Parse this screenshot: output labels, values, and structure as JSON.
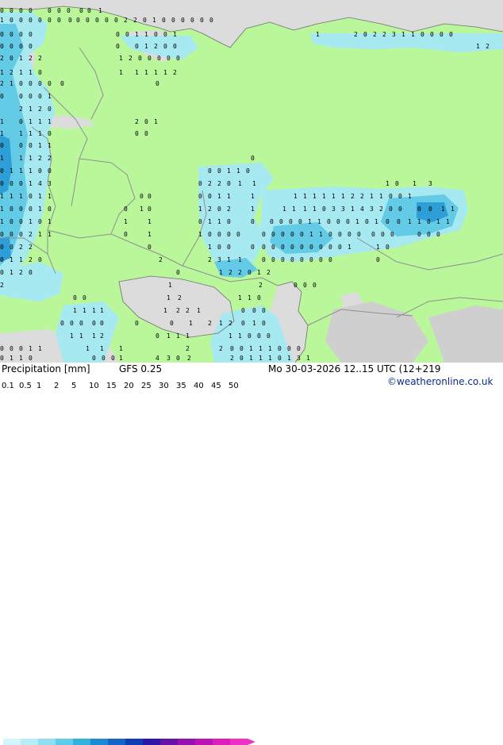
{
  "title": "Precipitation [mm]",
  "model": "GFS 0.25",
  "datetime": "Mo 30-03-2026 12..15 UTC (12+219",
  "credit": "©weatheronline.co.uk",
  "colors": {
    "land": "#b9f79a",
    "sea": "#dcdcdc",
    "light_precip": "#a7e9f1",
    "medium_precip": "#63cbe6",
    "heavy_precip": "#2e9fd6",
    "border": "#8f8f8f"
  },
  "legend": {
    "labels": [
      "0.1",
      "0.5",
      "1",
      "2",
      "5",
      "10",
      "15",
      "20",
      "25",
      "30",
      "35",
      "40",
      "45",
      "50"
    ],
    "colors": [
      "#d3f5fb",
      "#b6ecf7",
      "#8fdff1",
      "#5fcbe8",
      "#33b1dd",
      "#1e8bd1",
      "#1565c4",
      "#0e3eb5",
      "#2d15a7",
      "#6611a8",
      "#9510ad",
      "#bb13b3",
      "#de1cba",
      "#f02fc6"
    ]
  },
  "values": [
    "0",
    "0",
    "0",
    "0",
    "0",
    "0",
    "0",
    "0",
    "0",
    "1",
    "1",
    "0",
    "0",
    "0",
    "0",
    "0",
    "0",
    "0",
    "0",
    "0",
    "0",
    "0",
    "0",
    "2",
    "2",
    "0",
    "1",
    "0",
    "0",
    "0",
    "0",
    "0",
    "0",
    "0",
    "0",
    "0",
    "0",
    "0",
    "0",
    "1",
    "1",
    "0",
    "0",
    "1",
    "1",
    "2",
    "0",
    "2",
    "2",
    "3",
    "1",
    "1",
    "0",
    "0",
    "0",
    "0",
    "0",
    "0",
    "0",
    "0",
    "0",
    "0",
    "1",
    "2",
    "0",
    "0",
    "1",
    "2",
    "2",
    "0",
    "1",
    "2",
    "2",
    "1",
    "2",
    "0",
    "0",
    "0",
    "0",
    "0",
    "1",
    "2",
    "1",
    "1",
    "0",
    "1",
    "1",
    "1",
    "1",
    "1",
    "2",
    "2",
    "1",
    "0",
    "0",
    "0",
    "0",
    "0",
    "0",
    "0",
    "0",
    "0",
    "0",
    "1",
    "2",
    "1",
    "2",
    "0",
    "1",
    "0",
    "1",
    "1",
    "1",
    "2",
    "0",
    "1",
    "1",
    "1",
    "1",
    "1",
    "0",
    "0",
    "0",
    "0",
    "0",
    "0",
    "1",
    "1",
    "1",
    "1",
    "1",
    "2",
    "2",
    "0",
    "0",
    "1",
    "1",
    "1",
    "0",
    "0",
    "0",
    "0",
    "1",
    "1",
    "0",
    "0",
    "0",
    "0",
    "1",
    "4",
    "3",
    "0",
    "2",
    "2",
    "0",
    "1",
    "1",
    "1",
    "0",
    "1",
    "3",
    "1",
    "1",
    "1",
    "0",
    "1",
    "1",
    "0",
    "0",
    "0",
    "0",
    "1",
    "1",
    "1",
    "1",
    "1",
    "1",
    "1",
    "1",
    "1",
    "2",
    "2",
    "1",
    "1",
    "0",
    "0",
    "1",
    "1",
    "0",
    "0",
    "0",
    "1",
    "0",
    "0",
    "1",
    "0",
    "1",
    "2",
    "0",
    "2",
    "1",
    "1",
    "1",
    "1",
    "1",
    "0",
    "3",
    "3",
    "1",
    "4",
    "3",
    "2",
    "0",
    "0",
    "0",
    "0",
    "1",
    "1",
    "1",
    "0",
    "0",
    "1",
    "0",
    "1",
    "1",
    "1",
    "0",
    "1",
    "1",
    "0",
    "0",
    "0",
    "0",
    "0",
    "0",
    "1",
    "1",
    "0",
    "0",
    "0",
    "1",
    "0",
    "1",
    "0",
    "0",
    "1",
    "1",
    "0",
    "1",
    "1",
    "0",
    "0",
    "0",
    "2",
    "1",
    "1",
    "0",
    "1",
    "1"
  ]
}
